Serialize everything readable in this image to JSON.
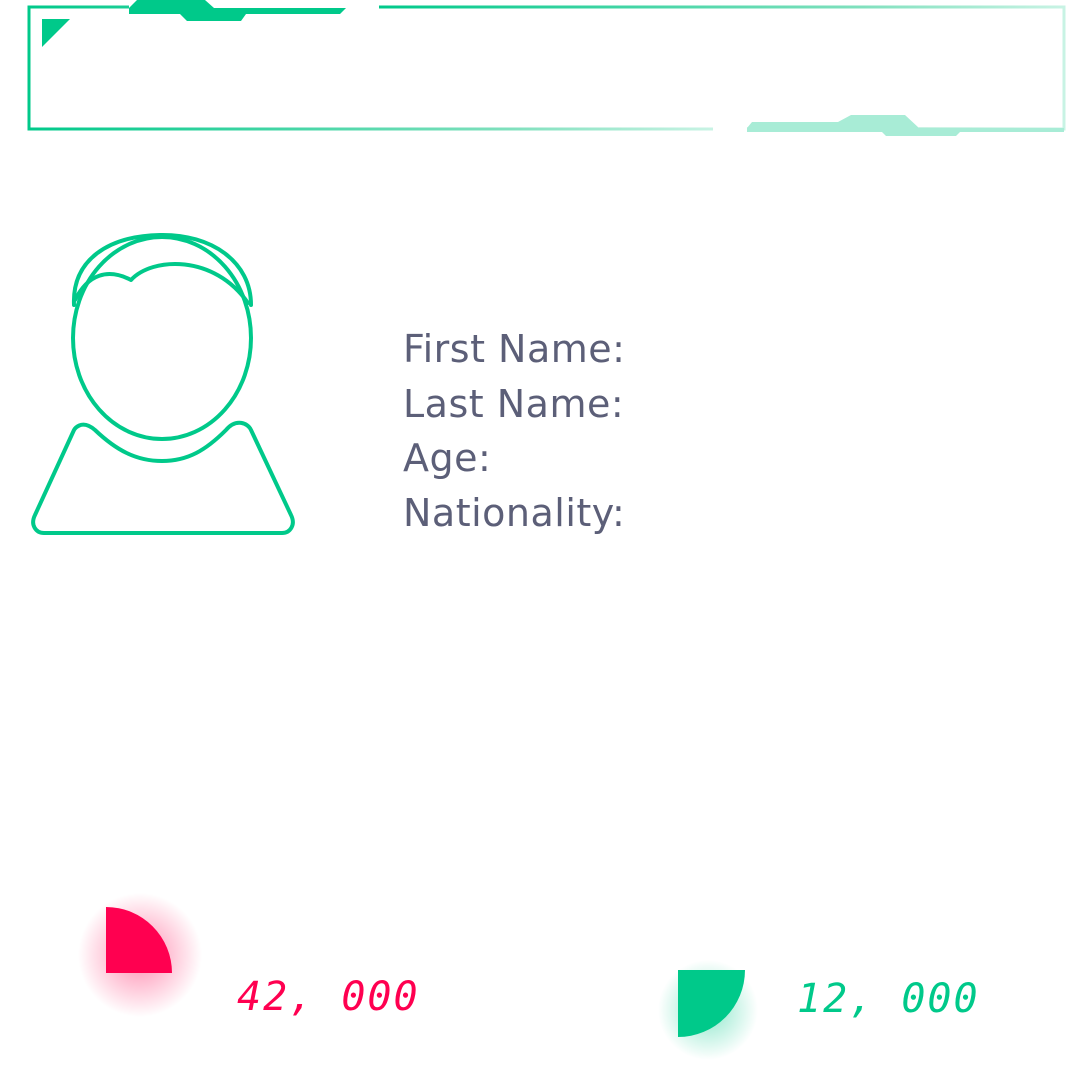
{
  "profile": {
    "fields": [
      {
        "label": "First Name:"
      },
      {
        "label": "Last Name:"
      },
      {
        "label": "Age:"
      },
      {
        "label": "Nationality:"
      }
    ]
  },
  "stats": [
    {
      "value": "42, 000",
      "color": "#ff0050",
      "icon": "pie-quarter-icon"
    },
    {
      "value": "12, 000",
      "color": "#00c98a",
      "icon": "pie-quarter-icon"
    }
  ],
  "colors": {
    "accent": "#00c98a",
    "accent_light": "#a8ecd6",
    "highlight": "#ff0050",
    "text": "#5c5f78",
    "background": "#ffffff"
  }
}
